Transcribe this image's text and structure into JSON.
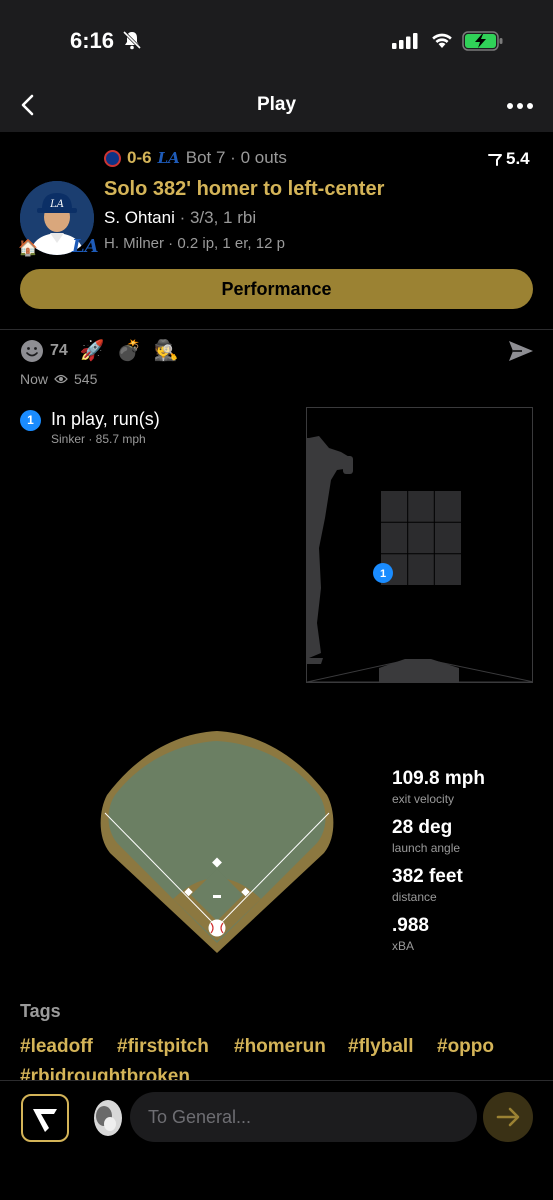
{
  "status_bar": {
    "time": "6:16"
  },
  "nav": {
    "title": "Play"
  },
  "game": {
    "score": "0-6",
    "inning": "Bot 7 · 0 outs",
    "trend_value": "5.4",
    "headline": "Solo 382' homer to left-center",
    "batter_name": "S. Ohtani",
    "batter_stats": " · 3/3, 1 rbi",
    "pitcher_line": "H. Milner · 0.2 ip, 1 er, 12 p",
    "team_badge": "LA"
  },
  "performance_label": "Performance",
  "reactions": {
    "count": "74",
    "time": "Now",
    "views": "545"
  },
  "pitch": {
    "number": "1",
    "result": "In play, run(s)",
    "detail": "Sinker · 85.7 mph"
  },
  "stats": [
    {
      "value": "109.8 mph",
      "label": "exit velocity"
    },
    {
      "value": "28 deg",
      "label": "launch angle"
    },
    {
      "value": "382 feet",
      "label": "distance"
    },
    {
      "value": ".988",
      "label": "xBA"
    }
  ],
  "tags": {
    "title": "Tags",
    "items": [
      "#leadoff",
      "#firstpitch",
      "#homerun",
      "#flyball",
      "#oppo",
      "#rbidroughtbroken"
    ]
  },
  "chat": {
    "placeholder": "To General..."
  },
  "colors": {
    "accent": "#d4b458",
    "button": "#9b8233",
    "pitch_marker": "#1a8cff"
  },
  "icons": [
    "bell-slash-icon",
    "wifi-icon",
    "battery-charging-icon",
    "back-chevron-icon",
    "more-icon",
    "trend-icon",
    "send-icon",
    "eye-icon",
    "arrow-right-icon"
  ]
}
